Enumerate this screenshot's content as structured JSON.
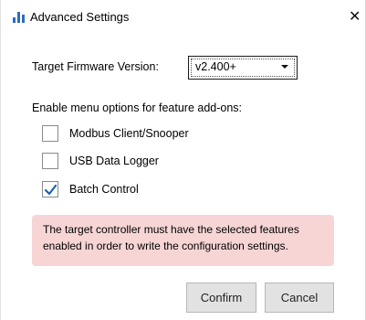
{
  "window": {
    "title": "Advanced Settings",
    "icon": "bar-chart-icon",
    "close_glyph": "✕"
  },
  "firmware": {
    "label": "Target Firmware Version:",
    "selected": "v2.400+"
  },
  "features": {
    "label": "Enable menu options for feature add-ons:",
    "options": [
      {
        "label": "Modbus Client/Snooper",
        "checked": false
      },
      {
        "label": "USB Data Logger",
        "checked": false
      },
      {
        "label": "Batch Control",
        "checked": true
      }
    ]
  },
  "notice": {
    "line1": "The target controller must have the selected features",
    "line2": "enabled in order to write the configuration settings."
  },
  "buttons": {
    "confirm": "Confirm",
    "cancel": "Cancel"
  },
  "colors": {
    "accent": "#2b6cc4",
    "notice_bg": "#f7d5d5",
    "check": "#1f5fb8"
  }
}
